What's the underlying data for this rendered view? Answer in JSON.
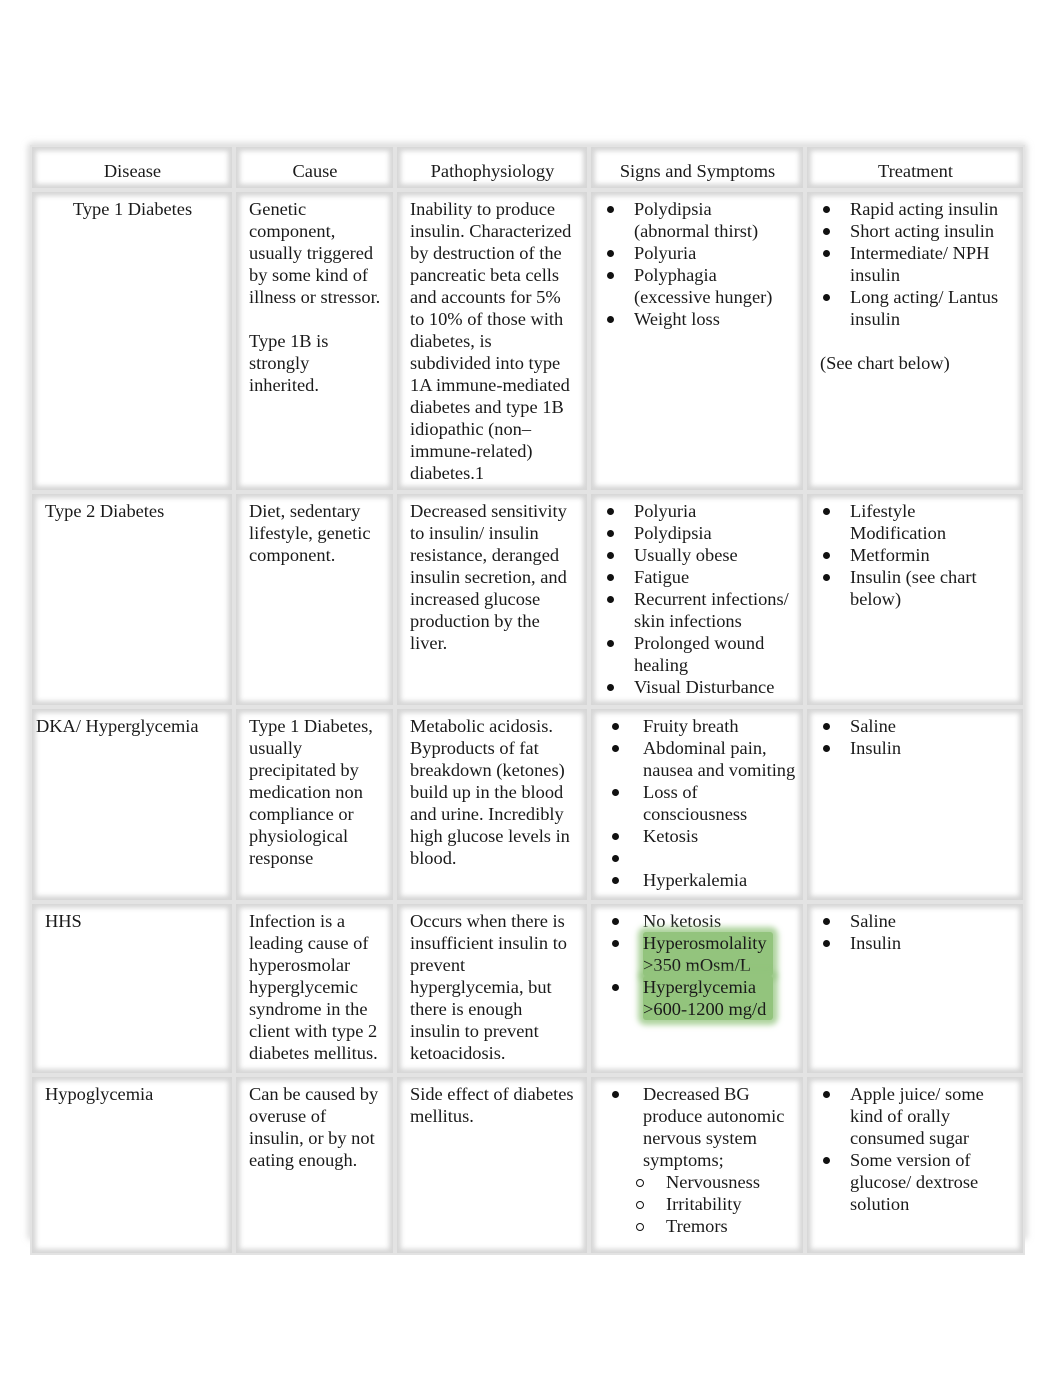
{
  "document": {
    "table": {
      "headers": [
        "Disease",
        "Cause",
        "Pathophysiology",
        "Signs and Symptoms",
        "Treatment"
      ],
      "rows": [
        {
          "disease": "Type 1 Diabetes",
          "cause": [
            "Genetic component, usually triggered by some kind of illness or stressor.",
            "Type 1B is strongly inherited."
          ],
          "pathophysiology": "Inability to produce insulin. Characterized by destruction of the pancreatic beta cells and accounts for 5% to 10% of those with diabetes, is subdivided into type 1A immune-mediated diabetes and type 1B idiopathic (non–immune-related) diabetes.1",
          "signs": [
            "Polydipsia (abnormal thirst)",
            "Polyuria",
            "Polyphagia (excessive hunger)",
            "Weight loss"
          ],
          "treatment": [
            "Rapid acting insulin",
            "Short acting insulin",
            "Intermediate/ NPH insulin",
            "Long acting/ Lantus insulin"
          ],
          "treatment_note": "(See chart below)"
        },
        {
          "disease": "Type 2 Diabetes",
          "cause": [
            "Diet, sedentary lifestyle, genetic component."
          ],
          "pathophysiology": "Decreased sensitivity to insulin/ insulin resistance, deranged insulin secretion, and increased glucose production by the liver.",
          "signs": [
            "Polyuria",
            "Polydipsia",
            "Usually obese",
            "Fatigue",
            "Recurrent infections/ skin infections",
            "Prolonged wound healing",
            "Visual Disturbance"
          ],
          "treatment": [
            "Lifestyle Modification",
            "Metformin",
            "Insulin (see chart below)"
          ]
        },
        {
          "disease": "DKA/ Hyperglycemia",
          "cause": [
            "Type 1 Diabetes, usually precipitated by medication non compliance or physiological response"
          ],
          "pathophysiology": "Metabolic acidosis. Byproducts of fat breakdown (ketones) build up in the blood and urine. Incredibly high glucose levels in blood.",
          "signs": [
            "Fruity breath",
            "Abdominal pain, nausea and vomiting",
            "Loss of consciousness",
            "Ketosis",
            "Hyperkalemia"
          ],
          "treatment": [
            "Saline",
            "Insulin"
          ]
        },
        {
          "disease": "HHS",
          "cause": [
            "Infection is a leading cause of hyperosmolar hyperglycemic syndrome in the client with type 2 diabetes mellitus."
          ],
          "pathophysiology": "Occurs when there is insufficient insulin to prevent hyperglycemia, but there is enough insulin to prevent ketoacidosis.",
          "signs": [
            "No ketosis",
            "Hyperosmolality >350 mOsm/L",
            "Hyperglycemia >600-1200 mg/d"
          ],
          "highlight_color": "#93c47d",
          "treatment": [
            "Saline",
            "Insulin"
          ]
        },
        {
          "disease": "Hypoglycemia",
          "cause": [
            "Can be caused by overuse of insulin, or by not eating enough."
          ],
          "pathophysiology": "Side effect of diabetes mellitus.",
          "signs": [
            "Decreased BG produce autonomic nervous system symptoms;"
          ],
          "sub_signs": [
            "Nervousness",
            "Irritability",
            "Tremors"
          ],
          "treatment": [
            "Apple juice/ some kind of orally consumed sugar",
            "Some version of glucose/ dextrose solution"
          ]
        }
      ]
    }
  }
}
